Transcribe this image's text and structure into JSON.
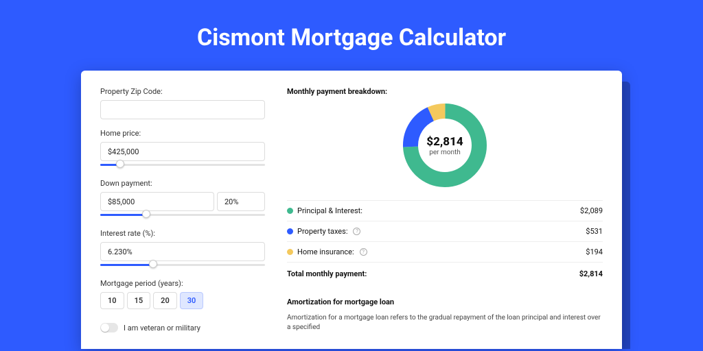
{
  "page_title": "Cismont Mortgage Calculator",
  "form": {
    "zip": {
      "label": "Property Zip Code:",
      "value": ""
    },
    "home_price": {
      "label": "Home price:",
      "value": "$425,000",
      "slider_pct": 12
    },
    "down_payment": {
      "label": "Down payment:",
      "value": "$85,000",
      "pct_value": "20%",
      "slider_pct": 28
    },
    "interest_rate": {
      "label": "Interest rate (%):",
      "value": "6.230%",
      "slider_pct": 32
    },
    "period": {
      "label": "Mortgage period (years):",
      "options": [
        "10",
        "15",
        "20",
        "30"
      ],
      "selected": "30"
    },
    "veteran": {
      "label": "I am veteran or military",
      "checked": false
    }
  },
  "breakdown": {
    "title": "Monthly payment breakdown:",
    "center_amount": "$2,814",
    "center_sub": "per month",
    "items": [
      {
        "label": "Principal & Interest:",
        "value": "$2,089",
        "color": "#3fb98f",
        "help": false
      },
      {
        "label": "Property taxes:",
        "value": "$531",
        "color": "#2e5bff",
        "help": true
      },
      {
        "label": "Home insurance:",
        "value": "$194",
        "color": "#f4c95d",
        "help": true
      }
    ],
    "total": {
      "label": "Total monthly payment:",
      "value": "$2,814"
    }
  },
  "amortization": {
    "title": "Amortization for mortgage loan",
    "text": "Amortization for a mortgage loan refers to the gradual repayment of the loan principal and interest over a specified"
  },
  "chart_data": {
    "type": "pie",
    "title": "Monthly payment breakdown",
    "series": [
      {
        "name": "Principal & Interest",
        "value": 2089,
        "color": "#3fb98f"
      },
      {
        "name": "Property taxes",
        "value": 531,
        "color": "#2e5bff"
      },
      {
        "name": "Home insurance",
        "value": 194,
        "color": "#f4c95d"
      }
    ],
    "total": 2814,
    "unit": "USD per month"
  }
}
